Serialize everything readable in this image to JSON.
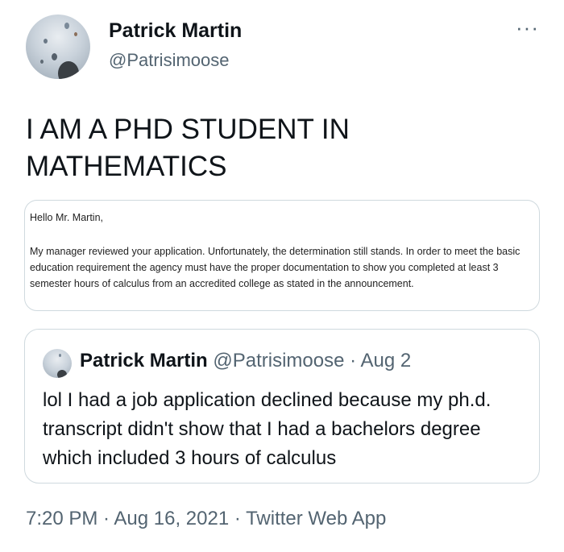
{
  "author": {
    "name": "Patrick Martin",
    "handle": "@Patrisimoose"
  },
  "more_label": "···",
  "tweet": {
    "text": "I AM A PHD STUDENT IN\nMATHEMATICS"
  },
  "email": {
    "greeting": "Hello Mr. Martin,",
    "body": "My manager reviewed your application. Unfortunately, the determination still stands. In order to meet the basic education requirement the agency must have the proper documentation to show you completed at least 3 semester hours of calculus from an accredited college as stated in the announcement."
  },
  "quoted_tweet": {
    "name": "Patrick Martin",
    "meta": " @Patrisimoose · Aug 2",
    "text": "lol I had a job application declined because my ph.d. transcript didn't show that I had a bachelors degree which included 3 hours of calculus"
  },
  "footer": {
    "timestamp": "7:20 PM · Aug 16, 2021 · Twitter Web App"
  }
}
